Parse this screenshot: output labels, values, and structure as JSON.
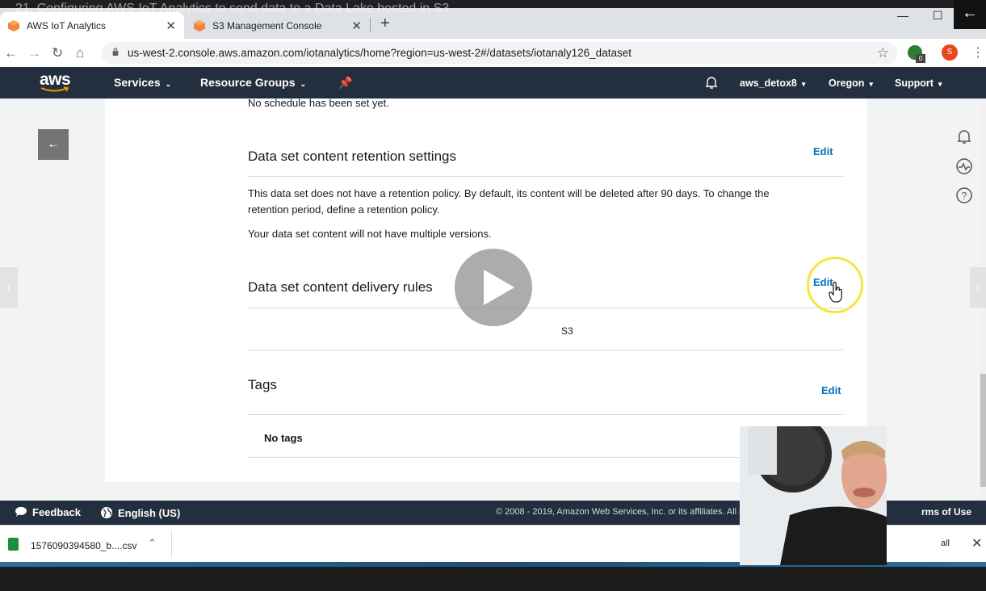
{
  "video": {
    "title": "21. Configuring AWS IoT Analytics to send data to a Data Lake hosted in S3"
  },
  "browser": {
    "tabs": [
      {
        "label": "AWS IoT Analytics",
        "active": true
      },
      {
        "label": "S3 Management Console",
        "active": false
      }
    ],
    "url": "us-west-2.console.aws.amazon.com/iotanalytics/home?region=us-west-2#/datasets/iotanaly126_dataset",
    "extension_badge": "0",
    "profile_initial": "S"
  },
  "aws_nav": {
    "logo": "aws",
    "services": "Services",
    "resource_groups": "Resource Groups",
    "account": "aws_detox8",
    "region": "Oregon",
    "support": "Support"
  },
  "content": {
    "schedule_text": "No schedule has been set yet.",
    "retention": {
      "heading": "Data set content retention settings",
      "edit_label": "Edit",
      "line1": "This data set does not have a retention policy. By default, its content will be deleted after 90 days. To change the",
      "line2": "retention period, define a retention policy.",
      "versions_text": "Your data set content will not have multiple versions."
    },
    "delivery": {
      "heading": "Data set content delivery rules",
      "edit_label": "Edit",
      "rule": "S3"
    },
    "tags": {
      "heading": "Tags",
      "edit_label": "Edit",
      "empty_text": "No tags"
    }
  },
  "footer": {
    "feedback": "Feedback",
    "language": "English (US)",
    "copyright": "© 2008 - 2019, Amazon Web Services, Inc. or its affiliates. All rights reser",
    "terms": "rms of Use"
  },
  "downloads": {
    "file": "1576090394580_b....csv",
    "show_all": "all"
  },
  "colors": {
    "aws_nav": "#232f3e",
    "link": "#0073bb",
    "highlight": "#f2e73c"
  }
}
